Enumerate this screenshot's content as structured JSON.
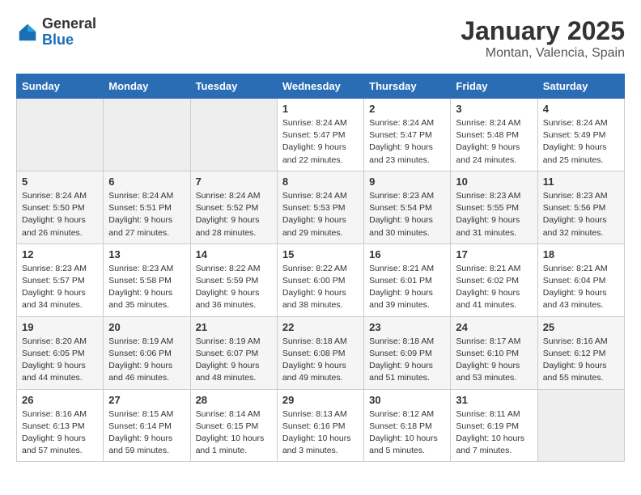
{
  "logo": {
    "general": "General",
    "blue": "Blue"
  },
  "header": {
    "title": "January 2025",
    "subtitle": "Montan, Valencia, Spain"
  },
  "days_of_week": [
    "Sunday",
    "Monday",
    "Tuesday",
    "Wednesday",
    "Thursday",
    "Friday",
    "Saturday"
  ],
  "weeks": [
    [
      {
        "day": "",
        "info": ""
      },
      {
        "day": "",
        "info": ""
      },
      {
        "day": "",
        "info": ""
      },
      {
        "day": "1",
        "info": "Sunrise: 8:24 AM\nSunset: 5:47 PM\nDaylight: 9 hours\nand 22 minutes."
      },
      {
        "day": "2",
        "info": "Sunrise: 8:24 AM\nSunset: 5:47 PM\nDaylight: 9 hours\nand 23 minutes."
      },
      {
        "day": "3",
        "info": "Sunrise: 8:24 AM\nSunset: 5:48 PM\nDaylight: 9 hours\nand 24 minutes."
      },
      {
        "day": "4",
        "info": "Sunrise: 8:24 AM\nSunset: 5:49 PM\nDaylight: 9 hours\nand 25 minutes."
      }
    ],
    [
      {
        "day": "5",
        "info": "Sunrise: 8:24 AM\nSunset: 5:50 PM\nDaylight: 9 hours\nand 26 minutes."
      },
      {
        "day": "6",
        "info": "Sunrise: 8:24 AM\nSunset: 5:51 PM\nDaylight: 9 hours\nand 27 minutes."
      },
      {
        "day": "7",
        "info": "Sunrise: 8:24 AM\nSunset: 5:52 PM\nDaylight: 9 hours\nand 28 minutes."
      },
      {
        "day": "8",
        "info": "Sunrise: 8:24 AM\nSunset: 5:53 PM\nDaylight: 9 hours\nand 29 minutes."
      },
      {
        "day": "9",
        "info": "Sunrise: 8:23 AM\nSunset: 5:54 PM\nDaylight: 9 hours\nand 30 minutes."
      },
      {
        "day": "10",
        "info": "Sunrise: 8:23 AM\nSunset: 5:55 PM\nDaylight: 9 hours\nand 31 minutes."
      },
      {
        "day": "11",
        "info": "Sunrise: 8:23 AM\nSunset: 5:56 PM\nDaylight: 9 hours\nand 32 minutes."
      }
    ],
    [
      {
        "day": "12",
        "info": "Sunrise: 8:23 AM\nSunset: 5:57 PM\nDaylight: 9 hours\nand 34 minutes."
      },
      {
        "day": "13",
        "info": "Sunrise: 8:23 AM\nSunset: 5:58 PM\nDaylight: 9 hours\nand 35 minutes."
      },
      {
        "day": "14",
        "info": "Sunrise: 8:22 AM\nSunset: 5:59 PM\nDaylight: 9 hours\nand 36 minutes."
      },
      {
        "day": "15",
        "info": "Sunrise: 8:22 AM\nSunset: 6:00 PM\nDaylight: 9 hours\nand 38 minutes."
      },
      {
        "day": "16",
        "info": "Sunrise: 8:21 AM\nSunset: 6:01 PM\nDaylight: 9 hours\nand 39 minutes."
      },
      {
        "day": "17",
        "info": "Sunrise: 8:21 AM\nSunset: 6:02 PM\nDaylight: 9 hours\nand 41 minutes."
      },
      {
        "day": "18",
        "info": "Sunrise: 8:21 AM\nSunset: 6:04 PM\nDaylight: 9 hours\nand 43 minutes."
      }
    ],
    [
      {
        "day": "19",
        "info": "Sunrise: 8:20 AM\nSunset: 6:05 PM\nDaylight: 9 hours\nand 44 minutes."
      },
      {
        "day": "20",
        "info": "Sunrise: 8:19 AM\nSunset: 6:06 PM\nDaylight: 9 hours\nand 46 minutes."
      },
      {
        "day": "21",
        "info": "Sunrise: 8:19 AM\nSunset: 6:07 PM\nDaylight: 9 hours\nand 48 minutes."
      },
      {
        "day": "22",
        "info": "Sunrise: 8:18 AM\nSunset: 6:08 PM\nDaylight: 9 hours\nand 49 minutes."
      },
      {
        "day": "23",
        "info": "Sunrise: 8:18 AM\nSunset: 6:09 PM\nDaylight: 9 hours\nand 51 minutes."
      },
      {
        "day": "24",
        "info": "Sunrise: 8:17 AM\nSunset: 6:10 PM\nDaylight: 9 hours\nand 53 minutes."
      },
      {
        "day": "25",
        "info": "Sunrise: 8:16 AM\nSunset: 6:12 PM\nDaylight: 9 hours\nand 55 minutes."
      }
    ],
    [
      {
        "day": "26",
        "info": "Sunrise: 8:16 AM\nSunset: 6:13 PM\nDaylight: 9 hours\nand 57 minutes."
      },
      {
        "day": "27",
        "info": "Sunrise: 8:15 AM\nSunset: 6:14 PM\nDaylight: 9 hours\nand 59 minutes."
      },
      {
        "day": "28",
        "info": "Sunrise: 8:14 AM\nSunset: 6:15 PM\nDaylight: 10 hours\nand 1 minute."
      },
      {
        "day": "29",
        "info": "Sunrise: 8:13 AM\nSunset: 6:16 PM\nDaylight: 10 hours\nand 3 minutes."
      },
      {
        "day": "30",
        "info": "Sunrise: 8:12 AM\nSunset: 6:18 PM\nDaylight: 10 hours\nand 5 minutes."
      },
      {
        "day": "31",
        "info": "Sunrise: 8:11 AM\nSunset: 6:19 PM\nDaylight: 10 hours\nand 7 minutes."
      },
      {
        "day": "",
        "info": ""
      }
    ]
  ]
}
